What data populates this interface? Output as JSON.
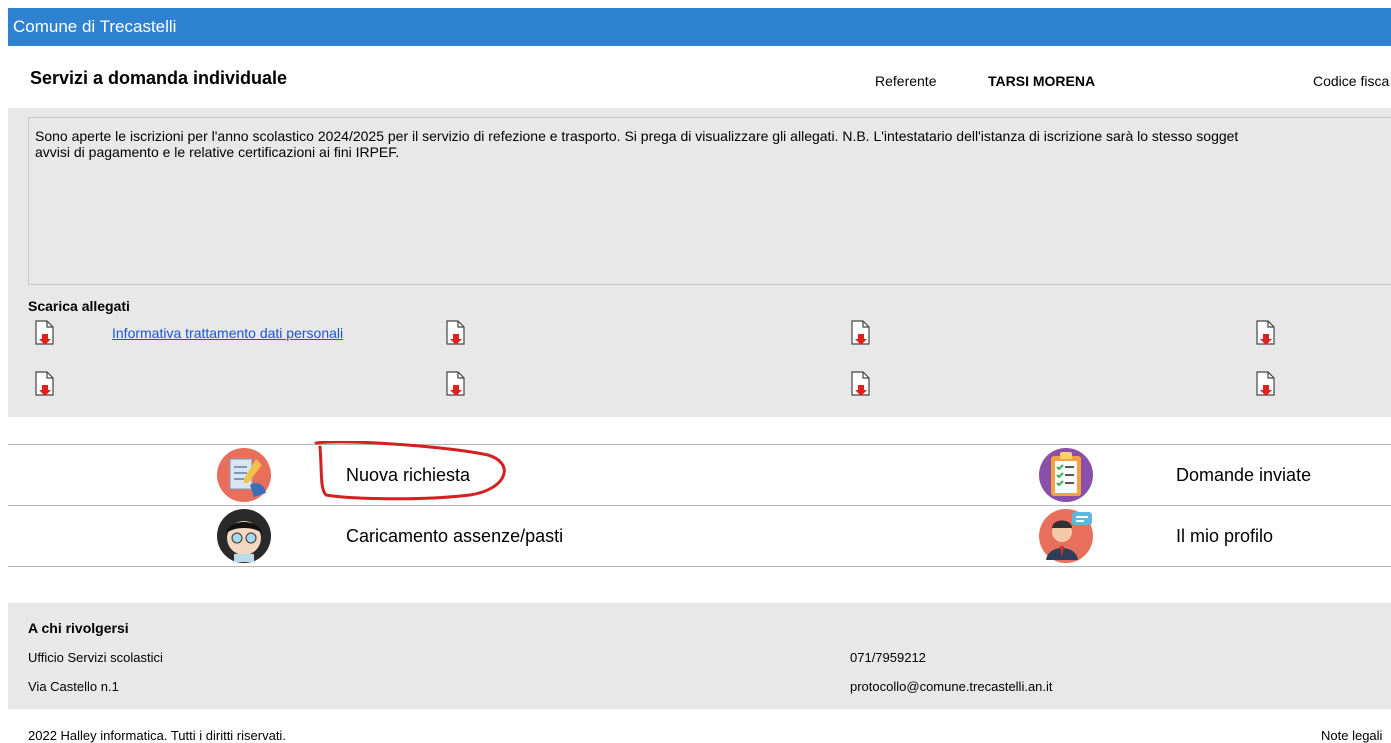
{
  "app": {
    "title": "Comune di Trecastelli"
  },
  "header": {
    "title": "Servizi a domanda individuale",
    "referente_label": "Referente",
    "referente_value": "TARSI MORENA",
    "codice_fiscale_label": "Codice fisca"
  },
  "notice": {
    "line1": "Sono aperte le iscrizioni per l'anno scolastico 2024/2025 per il servizio di refezione e trasporto. Si prega di visualizzare gli allegati.    N.B. L'intestatario dell'istanza di iscrizione sarà lo stesso sogget",
    "line2": "avvisi di pagamento e le relative certificazioni ai fini IRPEF."
  },
  "attachments": {
    "title": "Scarica allegati",
    "items": [
      {
        "label": "Informativa trattamento dati personali",
        "icon": "pdf-download-icon"
      },
      {
        "label": "",
        "icon": "pdf-download-icon"
      },
      {
        "label": "",
        "icon": "pdf-download-icon"
      },
      {
        "label": "",
        "icon": "pdf-download-icon"
      },
      {
        "label": "",
        "icon": "pdf-download-icon"
      },
      {
        "label": "",
        "icon": "pdf-download-icon"
      },
      {
        "label": "",
        "icon": "pdf-download-icon"
      },
      {
        "label": "",
        "icon": "pdf-download-icon"
      }
    ]
  },
  "menu": {
    "nuova_richiesta": {
      "label": "Nuova richiesta",
      "icon": "new-request-icon"
    },
    "domande_inviate": {
      "label": "Domande inviate",
      "icon": "sent-applications-icon"
    },
    "caricamento_assenze": {
      "label": "Caricamento assenze/pasti",
      "icon": "absences-meals-icon"
    },
    "mio_profilo": {
      "label": "Il mio profilo",
      "icon": "profile-icon"
    }
  },
  "contact": {
    "title": "A chi rivolgersi",
    "office": "Ufficio Servizi scolastici",
    "address": "Via Castello n.1",
    "phone": "071/7959212",
    "email": "protocollo@comune.trecastelli.an.it"
  },
  "footer": {
    "copyright": "2022 Halley informatica. Tutti i diritti riservati.",
    "legal": "Note legali"
  },
  "colors": {
    "topbar": "#2f82cf",
    "panel": "#e8e8e8",
    "link": "#1a55d6",
    "annotation": "#d42020"
  }
}
